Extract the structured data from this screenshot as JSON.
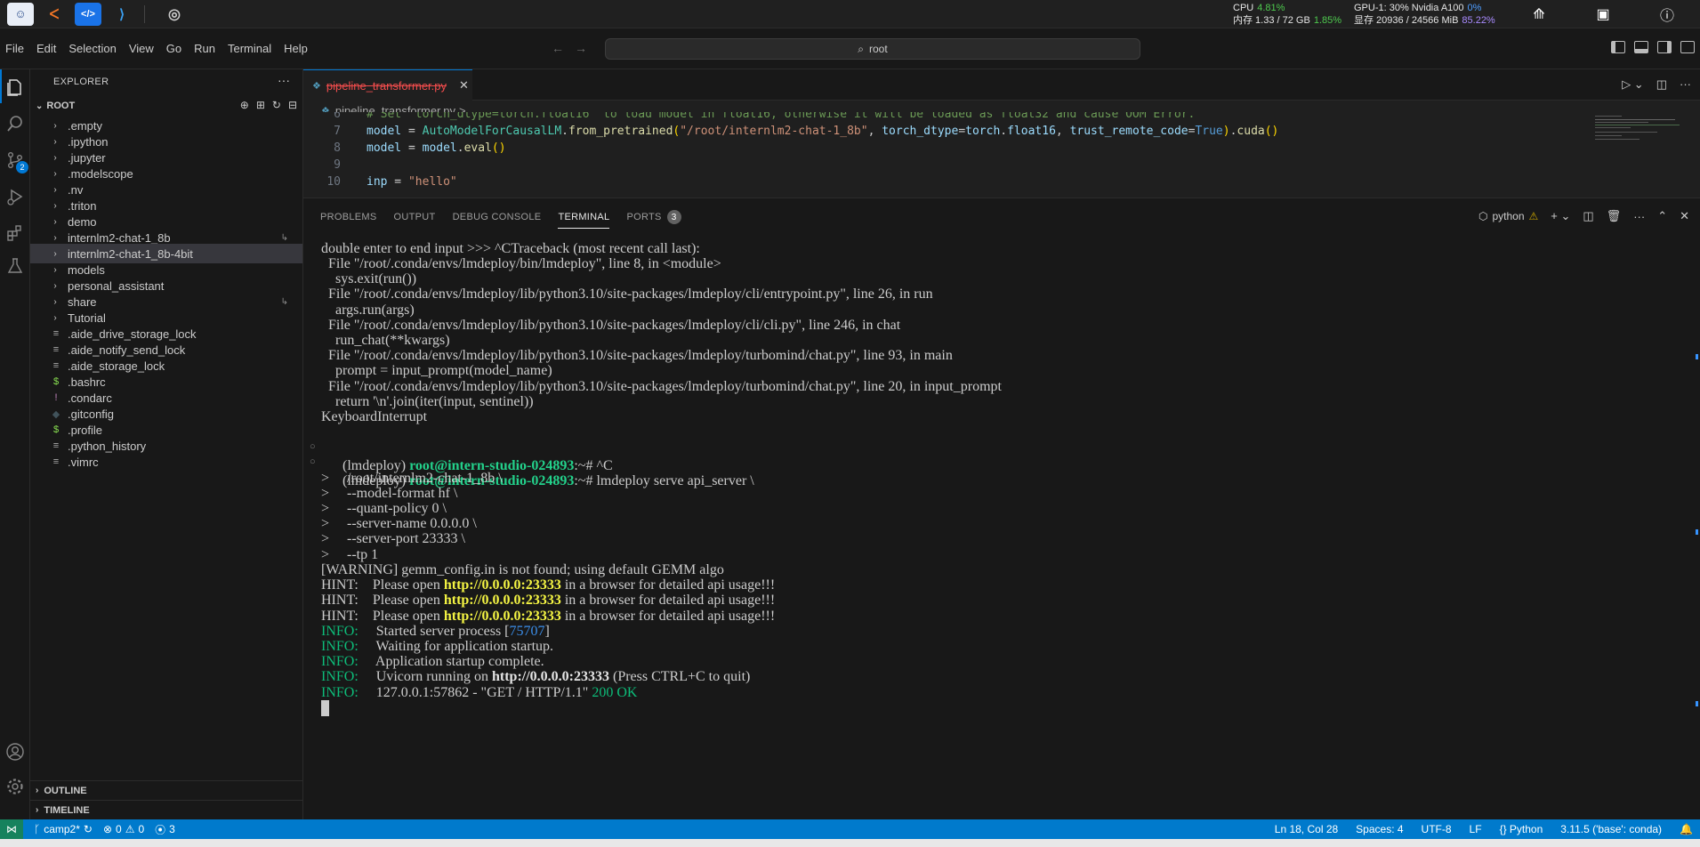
{
  "host": {
    "stats": {
      "cpu_label": "CPU",
      "cpu_value": "4.81%",
      "mem_label": "内存 1.33 / 72 GB",
      "mem_value": "1.85%",
      "gpu_label": "GPU-1: 30% Nvidia A100",
      "gpu_value": "0%",
      "vram_label": "显存 20936 / 24566 MiB",
      "vram_value": "85.22%"
    }
  },
  "menu": [
    "File",
    "Edit",
    "Selection",
    "View",
    "Go",
    "Run",
    "Terminal",
    "Help"
  ],
  "command_center": {
    "text": "root"
  },
  "explorer": {
    "title": "EXPLORER",
    "root_label": "ROOT",
    "items": [
      {
        "label": ".empty",
        "type": "folder"
      },
      {
        "label": ".ipython",
        "type": "folder"
      },
      {
        "label": ".jupyter",
        "type": "folder"
      },
      {
        "label": ".modelscope",
        "type": "folder"
      },
      {
        "label": ".nv",
        "type": "folder"
      },
      {
        "label": ".triton",
        "type": "folder"
      },
      {
        "label": "demo",
        "type": "folder"
      },
      {
        "label": "internlm2-chat-1_8b",
        "type": "folder",
        "symlink": true
      },
      {
        "label": "internlm2-chat-1_8b-4bit",
        "type": "folder",
        "selected": true
      },
      {
        "label": "models",
        "type": "folder"
      },
      {
        "label": "personal_assistant",
        "type": "folder"
      },
      {
        "label": "share",
        "type": "folder",
        "symlink": true
      },
      {
        "label": "Tutorial",
        "type": "folder"
      },
      {
        "label": ".aide_drive_storage_lock",
        "type": "file",
        "icon": "≡"
      },
      {
        "label": ".aide_notify_send_lock",
        "type": "file",
        "icon": "≡"
      },
      {
        "label": ".aide_storage_lock",
        "type": "file",
        "icon": "≡"
      },
      {
        "label": ".bashrc",
        "type": "file",
        "icon": "$"
      },
      {
        "label": ".condarc",
        "type": "file",
        "icon": "!"
      },
      {
        "label": ".gitconfig",
        "type": "file",
        "icon": "◆"
      },
      {
        "label": ".profile",
        "type": "file",
        "icon": "$"
      },
      {
        "label": ".python_history",
        "type": "file",
        "icon": "≡"
      },
      {
        "label": ".vimrc",
        "type": "file",
        "icon": "≡"
      }
    ],
    "outline_label": "OUTLINE",
    "timeline_label": "TIMELINE"
  },
  "editor": {
    "tab_label": "pipeline_transformer.py",
    "breadcrumb_file": "pipeline_transformer.py",
    "breadcrumb_rest": "> ...",
    "lines": [
      {
        "n": "6",
        "text": "# Set `torch_dtype=torch.float16` to load model in float16, otherwise it will be loaded as float32 and cause OOM Error."
      },
      {
        "n": "7",
        "text": "model = AutoModelForCausalLM.from_pretrained(\"/root/internlm2-chat-1_8b\", torch_dtype=torch.float16, trust_remote_code=True).cuda()"
      },
      {
        "n": "8",
        "text": "model = model.eval()"
      },
      {
        "n": "9",
        "text": ""
      },
      {
        "n": "10",
        "text": "inp = \"hello\""
      }
    ]
  },
  "panel": {
    "tabs": [
      "PROBLEMS",
      "OUTPUT",
      "DEBUG CONSOLE",
      "TERMINAL",
      "PORTS"
    ],
    "active_tab": "TERMINAL",
    "ports_count": "3",
    "terminal_name": "python"
  },
  "terminal": {
    "lines": [
      "double enter to end input >>> ^CTraceback (most recent call last):",
      "  File \"/root/.conda/envs/lmdeploy/bin/lmdeploy\", line 8, in <module>",
      "    sys.exit(run())",
      "  File \"/root/.conda/envs/lmdeploy/lib/python3.10/site-packages/lmdeploy/cli/entrypoint.py\", line 26, in run",
      "    args.run(args)",
      "  File \"/root/.conda/envs/lmdeploy/lib/python3.10/site-packages/lmdeploy/cli/cli.py\", line 246, in chat",
      "    run_chat(**kwargs)",
      "  File \"/root/.conda/envs/lmdeploy/lib/python3.10/site-packages/lmdeploy/turbomind/chat.py\", line 93, in main",
      "    prompt = input_prompt(model_name)",
      "  File \"/root/.conda/envs/lmdeploy/lib/python3.10/site-packages/lmdeploy/turbomind/chat.py\", line 20, in input_prompt",
      "    return '\\n'.join(iter(input, sentinel))",
      "KeyboardInterrupt"
    ],
    "prompt_env": "(lmdeploy) ",
    "prompt_host": "root@intern-studio-024893",
    "prompt_path": ":~",
    "prompt_end": "# ",
    "cmd1": "^C",
    "cmd2": "lmdeploy serve api_server \\",
    "cont_lines": [
      ">     /root/internlm2-chat-1_8b \\",
      ">     --model-format hf \\",
      ">     --quant-policy 0 \\",
      ">     --server-name 0.0.0.0 \\",
      ">     --server-port 23333 \\",
      ">     --tp 1"
    ],
    "warning": "[WARNING] gemm_config.in is not found; using default GEMM algo",
    "hint_prefix": "HINT:    Please open ",
    "hint_url": "http://0.0.0.0:23333",
    "hint_suffix": " in a browser for detailed api usage!!!",
    "info_label": "INFO:",
    "info1_a": "     Started server process [",
    "info1_pid": "75707",
    "info1_b": "]",
    "info2": "     Waiting for application startup.",
    "info3": "     Application startup complete.",
    "info4_a": "     Uvicorn running on ",
    "info4_url": "http://0.0.0.0:23333",
    "info4_b": " (Press CTRL+C to quit)",
    "info5_a": "     127.0.0.1:57862 - \"GET / HTTP/1.1\" ",
    "info5_status": "200 OK"
  },
  "statusbar": {
    "branch": "camp2*",
    "errors": "0",
    "warnings": "0",
    "ports": "3",
    "position": "Ln 18, Col 28",
    "spaces": "Spaces: 4",
    "encoding": "UTF-8",
    "eol": "LF",
    "language": "Python",
    "interpreter": "3.11.5 ('base': conda)"
  },
  "colors": {
    "accent": "#0078d4",
    "statusbar": "#007acc",
    "prompt_green": "#23d18b",
    "hint_yellow": "#f5f543"
  }
}
